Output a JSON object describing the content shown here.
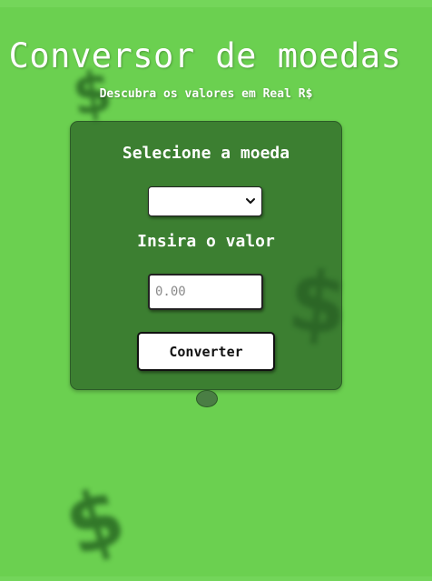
{
  "header": {
    "title": "Conversor de moedas",
    "subtitle": "Descubra os valores em Real R$"
  },
  "background": {
    "dollar_symbol": "$",
    "color": "#6bd050"
  },
  "form": {
    "select_label": "Selecione a moeda",
    "selected_currency": "",
    "value_label": "Insira o valor",
    "value_placeholder": "0.00",
    "value": "",
    "convert_label": "Converter"
  },
  "result": {
    "text": ""
  },
  "icons": {
    "select_arrow": "chevron-down-icon"
  },
  "colors": {
    "panel": "#2a5f26",
    "text": "#ffffff",
    "accent": "#6bd050"
  }
}
